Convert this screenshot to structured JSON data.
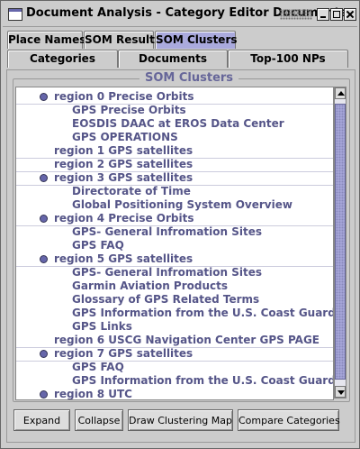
{
  "window": {
    "title": "Document Analysis - Category Editor Documents"
  },
  "tabs_row1": [
    {
      "label": "Place Names",
      "active": false
    },
    {
      "label": "SOM Result",
      "active": false
    },
    {
      "label": "SOM Clusters",
      "active": true
    }
  ],
  "tabs_row2": [
    {
      "label": "Categories"
    },
    {
      "label": "Documents"
    },
    {
      "label": "Top-100 NPs"
    }
  ],
  "group": {
    "title": "SOM Clusters"
  },
  "tree": [
    {
      "type": "region",
      "label": "region 0 Precise Orbits",
      "expanded": true
    },
    {
      "type": "doc",
      "label": "GPS Precise Orbits"
    },
    {
      "type": "doc",
      "label": "EOSDIS DAAC at EROS Data Center"
    },
    {
      "type": "doc",
      "label": "GPS OPERATIONS"
    },
    {
      "type": "region",
      "label": "region 1 GPS satellites",
      "expanded": false
    },
    {
      "type": "region",
      "label": "region 2 GPS satellites",
      "expanded": false
    },
    {
      "type": "region",
      "label": "region 3 GPS satellites",
      "expanded": true
    },
    {
      "type": "doc",
      "label": "Directorate of Time"
    },
    {
      "type": "doc",
      "label": "Global Positioning System Overview"
    },
    {
      "type": "region",
      "label": "region 4 Precise Orbits",
      "expanded": true
    },
    {
      "type": "doc",
      "label": "GPS- General Infromation Sites"
    },
    {
      "type": "doc",
      "label": "GPS FAQ"
    },
    {
      "type": "region",
      "label": "region 5 GPS satellites",
      "expanded": true
    },
    {
      "type": "doc",
      "label": "GPS- General Infromation Sites"
    },
    {
      "type": "doc",
      "label": "Garmin Aviation Products"
    },
    {
      "type": "doc",
      "label": "Glossary of GPS Related Terms"
    },
    {
      "type": "doc",
      "label": "GPS Information from the U.S. Coast Guard"
    },
    {
      "type": "doc",
      "label": "GPS Links"
    },
    {
      "type": "region",
      "label": "region 6 USCG Navigation Center GPS PAGE",
      "expanded": false
    },
    {
      "type": "region",
      "label": "region 7 GPS satellites",
      "expanded": true
    },
    {
      "type": "doc",
      "label": "GPS FAQ"
    },
    {
      "type": "doc",
      "label": "GPS Information from the U.S. Coast Guard"
    },
    {
      "type": "region",
      "label": "region 8 UTC",
      "expanded": true
    }
  ],
  "buttons": {
    "expand": "Expand",
    "collapse": "Collapse",
    "draw_map": "Draw Clustering Map",
    "compare": "Compare Categories"
  }
}
